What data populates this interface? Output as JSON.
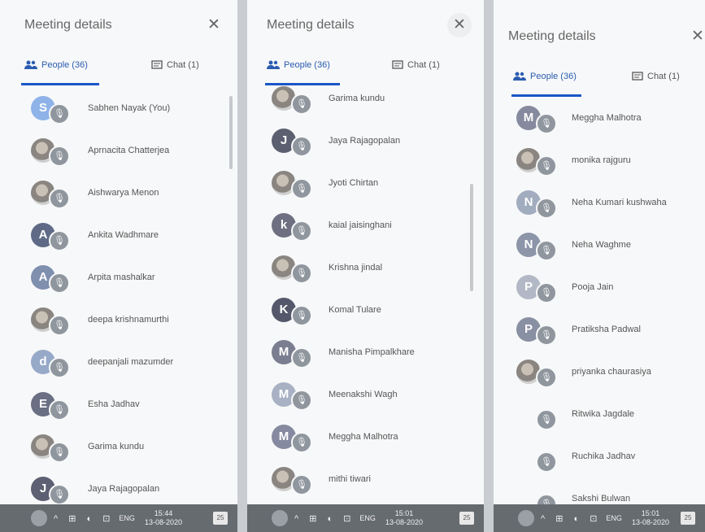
{
  "panels": [
    {
      "title": "Meeting details",
      "close_glyph": "✕",
      "tab_people": "People (36)",
      "tab_chat": "Chat (1)",
      "participants": [
        {
          "initial": "S",
          "name": "Sabhen Nayak (You)",
          "photo": false,
          "color": "#8fb3e8"
        },
        {
          "initial": "",
          "name": "Aprnacita Chatterjea",
          "photo": true,
          "color": ""
        },
        {
          "initial": "",
          "name": "Aishwarya Menon",
          "photo": true,
          "color": ""
        },
        {
          "initial": "A",
          "name": "Ankita Wadhmare",
          "photo": false,
          "color": "#5f6b86"
        },
        {
          "initial": "A",
          "name": "Arpita mashalkar",
          "photo": false,
          "color": "#7f8fae"
        },
        {
          "initial": "",
          "name": "deepa krishnamurthi",
          "photo": true,
          "color": ""
        },
        {
          "initial": "d",
          "name": "deepanjali mazumder",
          "photo": false,
          "color": "#97a9c8"
        },
        {
          "initial": "E",
          "name": "Esha Jadhav",
          "photo": false,
          "color": "#6b6f84"
        },
        {
          "initial": "",
          "name": "Garima kundu",
          "photo": true,
          "color": ""
        },
        {
          "initial": "J",
          "name": "Jaya Rajagopalan",
          "photo": false,
          "color": "#5d6072"
        }
      ],
      "taskbar": {
        "icons": "^ ⊞ ◐ ⊡",
        "lang": "ENG",
        "time": "15:44",
        "date": "13-08-2020",
        "notif": "25"
      }
    },
    {
      "title": "Meeting details",
      "close_glyph": "✕",
      "tab_people": "People (36)",
      "tab_chat": "Chat (1)",
      "participants": [
        {
          "initial": "",
          "name": "Garima kundu",
          "photo": true,
          "color": ""
        },
        {
          "initial": "J",
          "name": "Jaya Rajagopalan",
          "photo": false,
          "color": "#5c5f70"
        },
        {
          "initial": "",
          "name": "Jyoti Chirtan",
          "photo": true,
          "color": ""
        },
        {
          "initial": "k",
          "name": "kaial jaisinghani",
          "photo": false,
          "color": "#6e6f80"
        },
        {
          "initial": "",
          "name": "Krishna jindal",
          "photo": true,
          "color": ""
        },
        {
          "initial": "K",
          "name": "Komal Tulare",
          "photo": false,
          "color": "#55586a"
        },
        {
          "initial": "M",
          "name": "Manisha Pimpalkhare",
          "photo": false,
          "color": "#7a7e90"
        },
        {
          "initial": "M",
          "name": "Meenakshi Wagh",
          "photo": false,
          "color": "#a9b2c4"
        },
        {
          "initial": "M",
          "name": "Meggha Malhotra",
          "photo": false,
          "color": "#868aa0"
        },
        {
          "initial": "",
          "name": "mithi tiwari",
          "photo": true,
          "color": ""
        }
      ],
      "taskbar": {
        "icons": "^ ⊞ ◐ ⊡",
        "lang": "ENG",
        "time": "15:01",
        "date": "13-08-2020",
        "notif": "25"
      }
    },
    {
      "title": "Meeting details",
      "close_glyph": "✕",
      "tab_people": "People (36)",
      "tab_chat": "Chat (1)",
      "participants": [
        {
          "initial": "M",
          "name": "Meggha Malhotra",
          "photo": false,
          "color": "#858a9e"
        },
        {
          "initial": "",
          "name": "monika rajguru",
          "photo": true,
          "color": ""
        },
        {
          "initial": "N",
          "name": "Neha Kumari kushwaha",
          "photo": false,
          "color": "#a2acbf"
        },
        {
          "initial": "N",
          "name": "Neha Waghme",
          "photo": false,
          "color": "#8d95a9"
        },
        {
          "initial": "P",
          "name": "Pooja Jain",
          "photo": false,
          "color": "#b2b8c6"
        },
        {
          "initial": "P",
          "name": "Pratiksha Padwal",
          "photo": false,
          "color": "#8a90a3"
        },
        {
          "initial": "",
          "name": "priyanka chaurasiya",
          "photo": true,
          "color": ""
        },
        {
          "initial": "",
          "name": "Ritwika Jagdale",
          "photo": false,
          "color": "#f7f8f9"
        },
        {
          "initial": "",
          "name": "Ruchika Jadhav",
          "photo": false,
          "color": "#f7f8f9"
        },
        {
          "initial": "",
          "name": "Sakshi Bulwan",
          "photo": false,
          "color": "#f7f8f9"
        }
      ],
      "taskbar": {
        "icons": "^ ⊞ ◐ ⊡",
        "lang": "ENG",
        "time": "15:01",
        "date": "13-08-2020",
        "notif": "25"
      }
    }
  ]
}
